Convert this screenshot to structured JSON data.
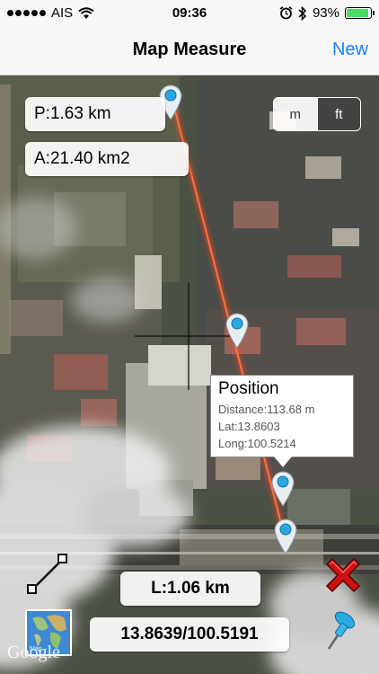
{
  "status": {
    "carrier": "AIS",
    "time": "09:36",
    "battery": "93%",
    "battery_level": 0.93
  },
  "nav": {
    "title": "Map Measure",
    "new_label": "New"
  },
  "map": {
    "perimeter": "P:1.63 km",
    "area": "A:21.40 km2",
    "units": {
      "meters": "m",
      "feet": "ft",
      "selected": "m"
    },
    "popup": {
      "title": "Position",
      "distance": "Distance:113.68 m",
      "lat": "Lat:13.8603",
      "long": "Long:100.5214"
    },
    "length": "L:1.06 km",
    "coordinates": "13.8639/100.5191",
    "map_type_label": "Map",
    "attribution": "Google"
  },
  "colors": {
    "accent": "#1a7efb",
    "route": "#ff4a1a",
    "delete_red": "#cc1111",
    "pin_blue": "#2aa8e0"
  },
  "icons": [
    "wifi-icon",
    "alarm-icon",
    "bluetooth-icon",
    "battery-icon",
    "crosshair-icon",
    "map-pin-icon",
    "line-tool-icon",
    "delete-icon",
    "drop-pin-icon",
    "map-type-icon"
  ]
}
